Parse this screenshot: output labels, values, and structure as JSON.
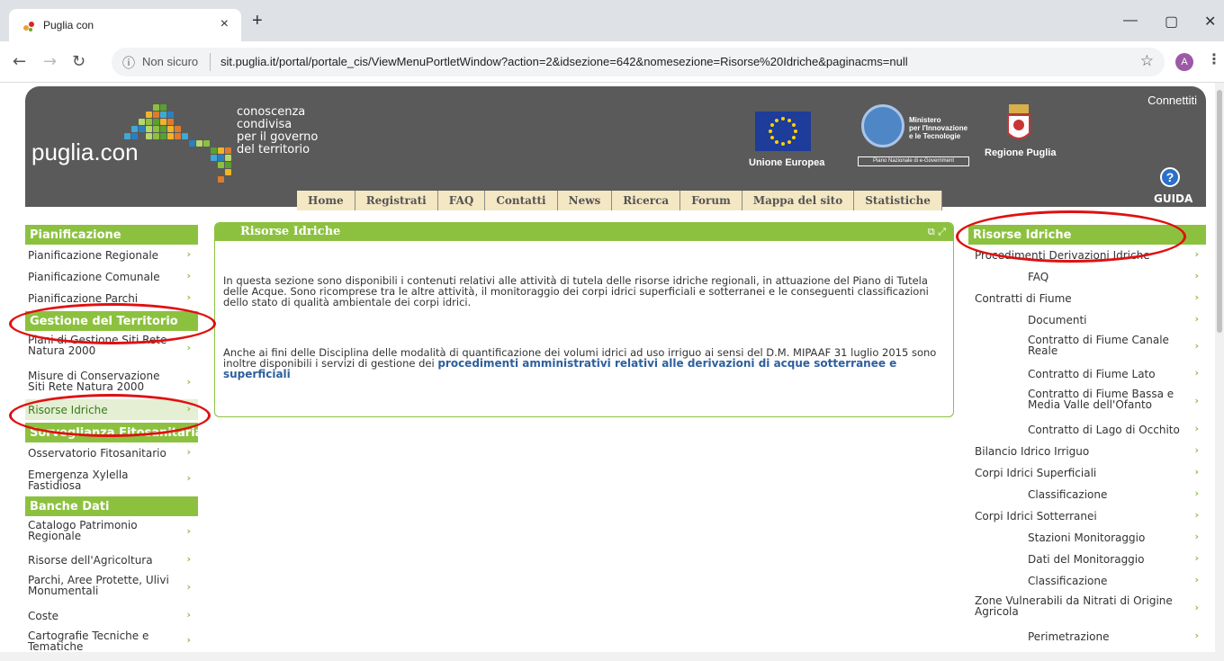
{
  "browser": {
    "tab_title": "Puglia con",
    "tab_close": "×",
    "new_tab": "+",
    "not_secure": "Non sicuro",
    "url": "sit.puglia.it/portal/portale_cis/ViewMenuPortletWindow?action=2&idsezione=642&nomesezione=Risorse%20Idriche&paginacms=null",
    "avatar_letter": "A",
    "minimize": "—",
    "maximize": "▢",
    "close": "✕"
  },
  "header": {
    "logo": "puglia.con",
    "tagline": "conoscenza\ncondivisa\nper il governo\ndel territorio",
    "connect": "Connettiti",
    "eu_label": "Unione Europea",
    "ministry": "Ministero\nper l'Innovazione\ne le Tecnologie",
    "ministry_plan": "Piano Nazionale di e-Government",
    "region": "Regione Puglia",
    "guide": "GUIDA",
    "help_symbol": "?"
  },
  "topnav": [
    "Home",
    "Registrati",
    "FAQ",
    "Contatti",
    "News",
    "Ricerca",
    "Forum",
    "Mappa del sito",
    "Statistiche"
  ],
  "left_menu": {
    "sections": [
      {
        "title": "Pianificazione",
        "items": [
          "Pianificazione Regionale",
          "Pianificazione Comunale",
          "Pianificazione Parchi"
        ]
      },
      {
        "title": "Gestione del Territorio",
        "items": [
          "Piani di Gestione Siti Rete Natura 2000",
          "Misure di Conservazione Siti Rete Natura 2000",
          "Risorse Idriche"
        ]
      },
      {
        "title": "Sorveglianza Fitosanitaria",
        "items": [
          "Osservatorio Fitosanitario",
          "Emergenza Xylella Fastidiosa"
        ]
      },
      {
        "title": "Banche Dati",
        "items": [
          "Catalogo Patrimonio Regionale",
          "Risorse dell'Agricoltura",
          "Parchi, Aree Protette, Ulivi Monumentali",
          "Coste",
          "Cartografie Tecniche e Tematiche"
        ]
      }
    ],
    "selected": "Risorse Idriche"
  },
  "content": {
    "title": "Risorse Idriche",
    "para1": "In questa sezione sono disponibili i contenuti relativi alle attività di tutela delle risorse idriche regionali, in attuazione del Piano di Tutela delle Acque. Sono ricomprese tra le altre attività, il monitoraggio dei corpi idrici superficiali e sotterranei e le conseguenti classificazioni dello stato di qualità ambientale dei corpi idrici.",
    "para2": "Anche ai fini delle Disciplina delle modalità di quantificazione dei volumi idrici ad uso irriguo ai sensi del D.M. MIPAAF 31 luglio 2015 sono inoltre disponibili i servizi di gestione dei ",
    "link": "procedimenti amministrativi relativi alle derivazioni di acque sotterranee e superficiali"
  },
  "right_menu": {
    "title": "Risorse Idriche",
    "items": [
      {
        "label": "Procedimenti Derivazioni Idriche",
        "sub": false
      },
      {
        "label": "FAQ",
        "sub": true
      },
      {
        "label": "Contratti di Fiume",
        "sub": false
      },
      {
        "label": "Documenti",
        "sub": true
      },
      {
        "label": "Contratto di Fiume Canale Reale",
        "sub": true
      },
      {
        "label": "Contratto di Fiume Lato",
        "sub": true
      },
      {
        "label": "Contratto di Fiume Bassa e Media Valle dell'Ofanto",
        "sub": true
      },
      {
        "label": "Contratto di Lago di Occhito",
        "sub": true
      },
      {
        "label": "Bilancio Idrico Irriguo",
        "sub": false
      },
      {
        "label": "Corpi Idrici Superficiali",
        "sub": false
      },
      {
        "label": "Classificazione",
        "sub": true
      },
      {
        "label": "Corpi Idrici Sotterranei",
        "sub": false
      },
      {
        "label": "Stazioni Monitoraggio",
        "sub": true
      },
      {
        "label": "Dati del Monitoraggio",
        "sub": true
      },
      {
        "label": "Classificazione",
        "sub": true
      },
      {
        "label": "Zone Vulnerabili da Nitrati di Origine Agricola",
        "sub": false
      },
      {
        "label": "Perimetrazione",
        "sub": true
      }
    ]
  },
  "colors": {
    "accent": "#8cc13f",
    "header_bg": "#5a5a5a",
    "annotation": "#e01010"
  }
}
